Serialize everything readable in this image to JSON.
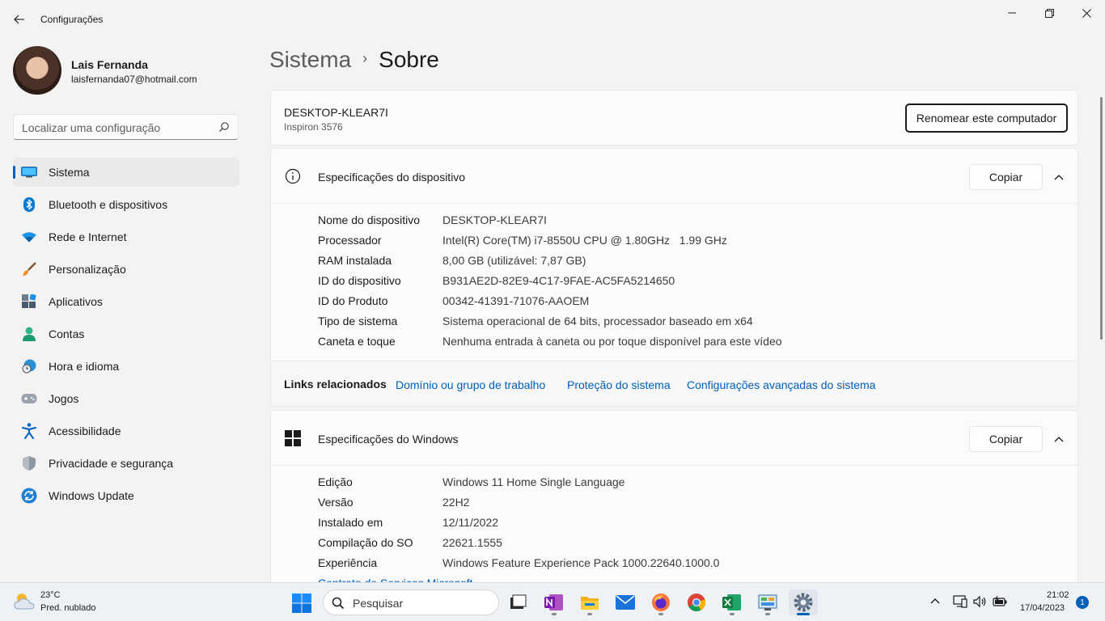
{
  "window": {
    "title": "Configurações",
    "back_icon": "arrow-left-icon",
    "minimize_icon": "minimize-icon",
    "maximize_icon": "maximize-icon",
    "close_icon": "close-icon"
  },
  "user": {
    "name": "Lais Fernanda",
    "email": "laisfernanda07@hotmail.com"
  },
  "search": {
    "placeholder": "Localizar uma configuração",
    "icon": "search-icon"
  },
  "sidebar": {
    "items": [
      {
        "label": "Sistema",
        "icon": "monitor-icon",
        "active": true
      },
      {
        "label": "Bluetooth e dispositivos",
        "icon": "bluetooth-icon"
      },
      {
        "label": "Rede e Internet",
        "icon": "wifi-icon"
      },
      {
        "label": "Personalização",
        "icon": "brush-icon"
      },
      {
        "label": "Aplicativos",
        "icon": "apps-icon"
      },
      {
        "label": "Contas",
        "icon": "person-icon"
      },
      {
        "label": "Hora e idioma",
        "icon": "globe-clock-icon"
      },
      {
        "label": "Jogos",
        "icon": "gamepad-icon"
      },
      {
        "label": "Acessibilidade",
        "icon": "accessibility-icon"
      },
      {
        "label": "Privacidade e segurança",
        "icon": "shield-icon"
      },
      {
        "label": "Windows Update",
        "icon": "update-icon"
      }
    ]
  },
  "breadcrumb": {
    "parent": "Sistema",
    "separator": "›",
    "current": "Sobre"
  },
  "pc": {
    "name": "DESKTOP-KLEAR7I",
    "model": "Inspiron 3576",
    "rename_label": "Renomear este computador"
  },
  "device_specs": {
    "title": "Especificações do dispositivo",
    "copy_label": "Copiar",
    "rows": [
      {
        "key": "Nome do dispositivo",
        "value": "DESKTOP-KLEAR7I"
      },
      {
        "key": "Processador",
        "value": "Intel(R) Core(TM) i7-8550U CPU @ 1.80GHz   1.99 GHz"
      },
      {
        "key": "RAM instalada",
        "value": "8,00 GB (utilizável: 7,87 GB)"
      },
      {
        "key": "ID do dispositivo",
        "value": "B931AE2D-82E9-4C17-9FAE-AC5FA5214650"
      },
      {
        "key": "ID do Produto",
        "value": "00342-41391-71076-AAOEM"
      },
      {
        "key": "Tipo de sistema",
        "value": "Sistema operacional de 64 bits, processador baseado em x64"
      },
      {
        "key": "Caneta e toque",
        "value": "Nenhuma entrada à caneta ou por toque disponível para este vídeo"
      }
    ],
    "related_label": "Links relacionados",
    "related_links": [
      "Domínio ou grupo de trabalho",
      "Proteção do sistema",
      "Configurações avançadas do sistema"
    ]
  },
  "windows_specs": {
    "title": "Especificações do Windows",
    "copy_label": "Copiar",
    "rows": [
      {
        "key": "Edição",
        "value": "Windows 11 Home Single Language"
      },
      {
        "key": "Versão",
        "value": "22H2"
      },
      {
        "key": "Instalado em",
        "value": "12/11/2022"
      },
      {
        "key": "Compilação do SO",
        "value": "22621.1555"
      },
      {
        "key": "Experiência",
        "value": "Windows Feature Experience Pack 1000.22640.1000.0"
      }
    ],
    "partial_link": "Contrato de Serviços Microsoft"
  },
  "taskbar": {
    "weather_temp": "23°C",
    "weather_desc": "Pred. nublado",
    "search_label": "Pesquisar",
    "apps": [
      "task-view-icon",
      "onenote-icon",
      "file-explorer-icon",
      "mail-icon",
      "firefox-icon",
      "chrome-icon",
      "excel-icon",
      "control-panel-icon",
      "settings-icon"
    ],
    "time": "21:02",
    "date": "17/04/2023",
    "notifications": "1"
  },
  "colors": {
    "accent": "#005fb8",
    "background": "#f3f3f3",
    "card": "#fbfbfb"
  }
}
